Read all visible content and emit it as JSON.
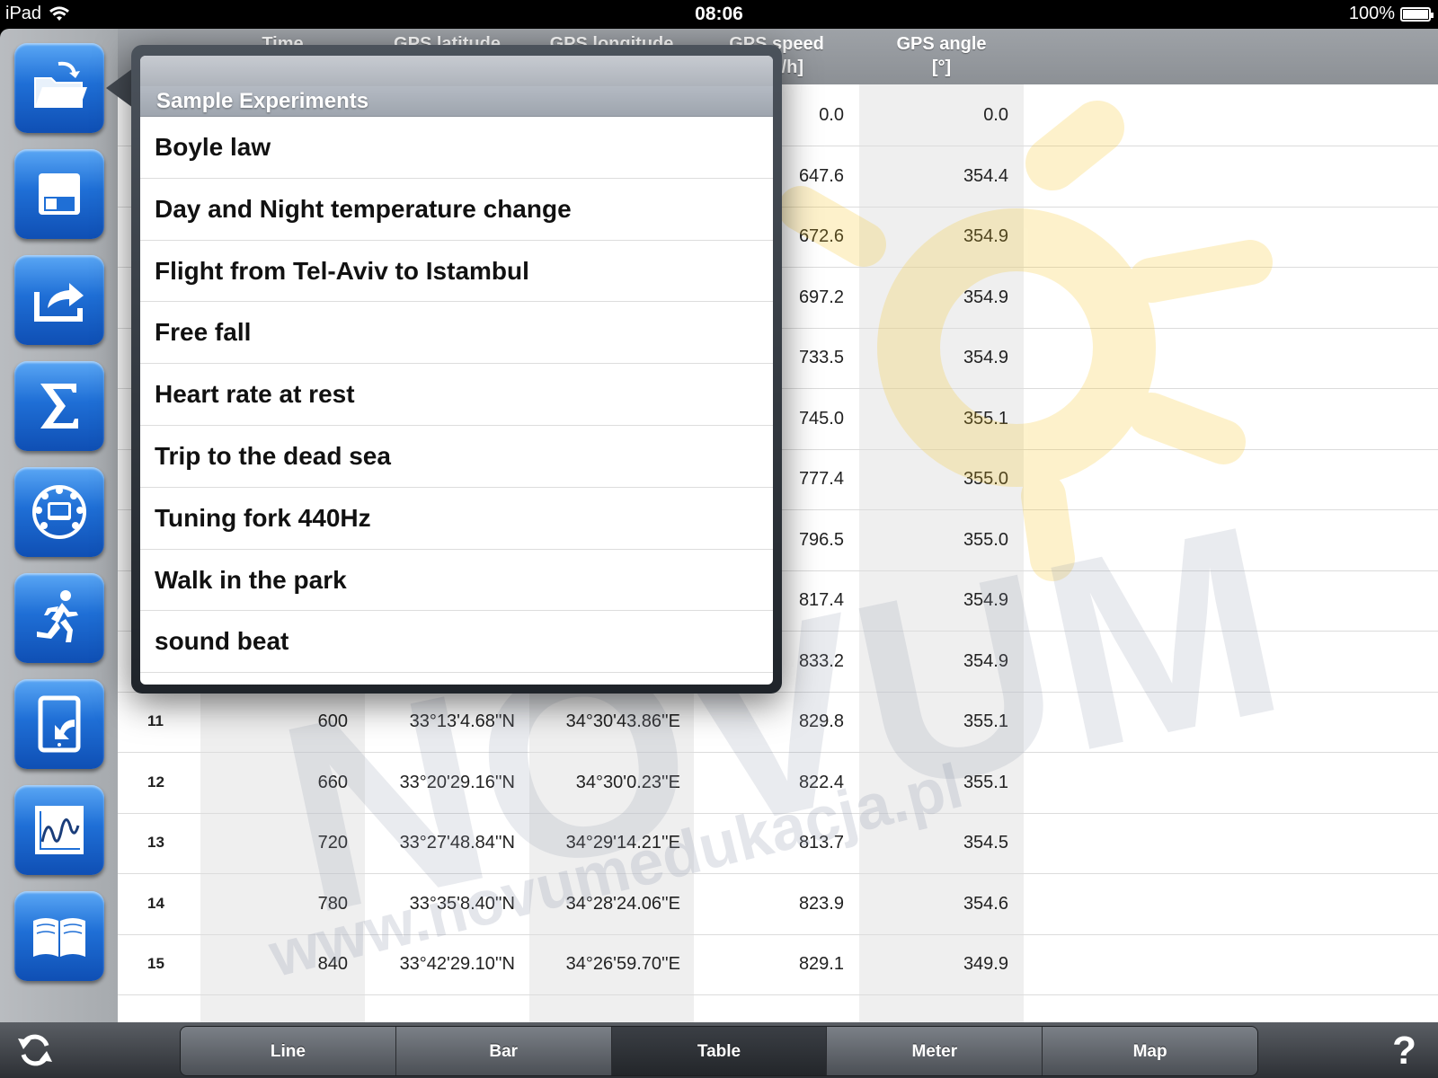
{
  "status_bar": {
    "device": "iPad",
    "time": "08:06",
    "battery": "100%",
    "battery_level": 1.0
  },
  "sidebar": {
    "buttons": [
      {
        "icon": "open-folder-icon"
      },
      {
        "icon": "save-icon"
      },
      {
        "icon": "export-icon"
      },
      {
        "icon": "sigma-icon"
      },
      {
        "icon": "sensor-dial-icon"
      },
      {
        "icon": "runner-icon"
      },
      {
        "icon": "tablet-import-icon"
      },
      {
        "icon": "graph-icon"
      },
      {
        "icon": "book-icon"
      }
    ]
  },
  "table": {
    "headers": {
      "time": "Time",
      "lat": "GPS latitude",
      "lon": "GPS longitude",
      "speed": "GPS speed",
      "speed_unit": "[km/h]",
      "angle": "GPS angle",
      "angle_unit": "[°]"
    },
    "rows": [
      {
        "idx": "",
        "time": "",
        "lat": "",
        "lon": "",
        "speed": "0.0",
        "angle": "0.0"
      },
      {
        "idx": "",
        "time": "",
        "lat": "",
        "lon": "",
        "speed": "647.6",
        "angle": "354.4"
      },
      {
        "idx": "",
        "time": "",
        "lat": "",
        "lon": "",
        "speed": "672.6",
        "angle": "354.9"
      },
      {
        "idx": "",
        "time": "",
        "lat": "",
        "lon": "",
        "speed": "697.2",
        "angle": "354.9"
      },
      {
        "idx": "",
        "time": "",
        "lat": "",
        "lon": "",
        "speed": "733.5",
        "angle": "354.9"
      },
      {
        "idx": "",
        "time": "",
        "lat": "",
        "lon": "",
        "speed": "745.0",
        "angle": "355.1"
      },
      {
        "idx": "",
        "time": "",
        "lat": "",
        "lon": "",
        "speed": "777.4",
        "angle": "355.0"
      },
      {
        "idx": "",
        "time": "",
        "lat": "",
        "lon": "",
        "speed": "796.5",
        "angle": "355.0"
      },
      {
        "idx": "",
        "time": "",
        "lat": "",
        "lon": "",
        "speed": "817.4",
        "angle": "354.9"
      },
      {
        "idx": "",
        "time": "",
        "lat": "",
        "lon": "",
        "speed": "833.2",
        "angle": "354.9"
      },
      {
        "idx": "11",
        "time": "600",
        "lat": "33°13'4.68''N",
        "lon": "34°30'43.86''E",
        "speed": "829.8",
        "angle": "355.1"
      },
      {
        "idx": "12",
        "time": "660",
        "lat": "33°20'29.16''N",
        "lon": "34°30'0.23''E",
        "speed": "822.4",
        "angle": "355.1"
      },
      {
        "idx": "13",
        "time": "720",
        "lat": "33°27'48.84''N",
        "lon": "34°29'14.21''E",
        "speed": "813.7",
        "angle": "354.5"
      },
      {
        "idx": "14",
        "time": "780",
        "lat": "33°35'8.40''N",
        "lon": "34°28'24.06''E",
        "speed": "823.9",
        "angle": "354.6"
      },
      {
        "idx": "15",
        "time": "840",
        "lat": "33°42'29.10''N",
        "lon": "34°26'59.70''E",
        "speed": "829.1",
        "angle": "349.9"
      }
    ]
  },
  "popover": {
    "section_title": "Sample Experiments",
    "items": [
      "Boyle law",
      "Day and Night temperature change",
      "Flight from Tel-Aviv to Istambul",
      "Free fall",
      "Heart rate at rest",
      "Trip to the dead sea",
      "Tuning fork 440Hz",
      "Walk in the park",
      "sound beat"
    ]
  },
  "toolbar": {
    "tabs": [
      "Line",
      "Bar",
      "Table",
      "Meter",
      "Map"
    ],
    "active_tab": "Table",
    "help": "?"
  },
  "watermark": {
    "brand": "NOVUM",
    "url": "www.novumedukacja.pl"
  }
}
